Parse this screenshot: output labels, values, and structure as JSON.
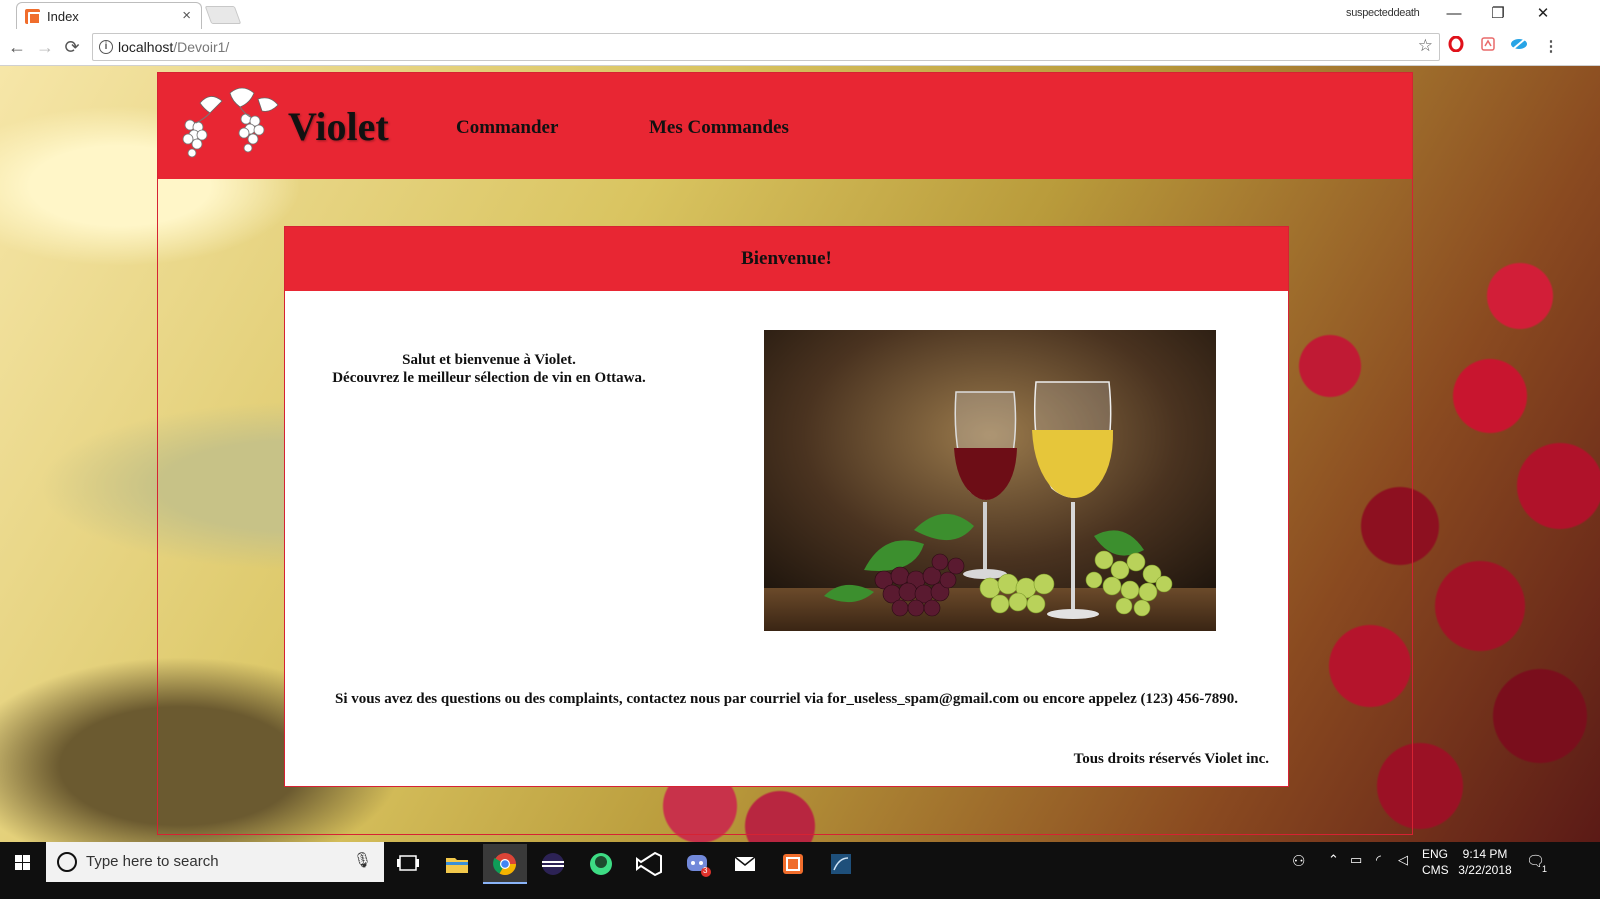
{
  "browser": {
    "tab_title": "Index",
    "tab_close": "×",
    "profile": "suspecteddeath",
    "window_controls": {
      "minimize": "—",
      "restore": "❐",
      "close": "✕"
    },
    "nav": {
      "back": "←",
      "forward": "→",
      "reload": "⟳"
    },
    "url_host": "localhost",
    "url_path": "/Devoir1/",
    "info_glyph": "i",
    "bookmark_glyph": "☆",
    "extensions": [
      "opera-icon",
      "pdf-extension-icon",
      "vpn-extension-icon",
      "menu-icon"
    ]
  },
  "site": {
    "logo_text": "Violet",
    "nav": [
      "Commander",
      "Mes Commandes"
    ],
    "panel_title": "Bienvenue!",
    "welcome_line1": "Salut et bienvenue à Violet.",
    "welcome_line2": "Découvrez le meilleur sélection de vin en Ottawa.",
    "contact": "Si vous avez des questions ou des complaints, contactez nous par courriel via for_useless_spam@gmail.com ou encore appelez (123) 456-7890.",
    "rights": "Tous droits réservés Violet inc."
  },
  "taskbar": {
    "search_placeholder": "Type here to search",
    "apps": [
      "task-view-icon",
      "file-explorer-icon",
      "chrome-icon",
      "eclipse-icon",
      "android-studio-icon",
      "visual-studio-icon",
      "discord-icon",
      "mail-icon",
      "xampp-icon",
      "sql-icon"
    ],
    "discord_badge": "3",
    "lang_line1": "ENG",
    "lang_line2": "CMS",
    "time": "9:14 PM",
    "date": "3/22/2018",
    "notification_count": "1"
  }
}
